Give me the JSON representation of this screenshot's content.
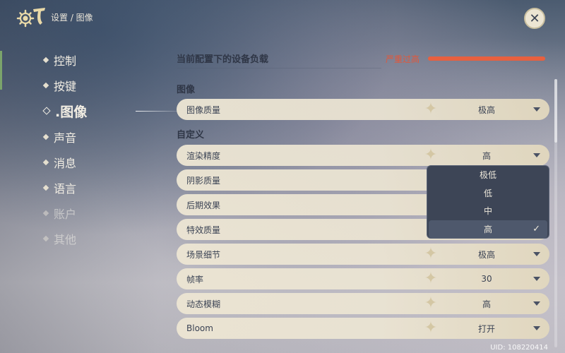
{
  "header": {
    "breadcrumb": "设置 / 图像",
    "close_label": "✕"
  },
  "sidebar": {
    "items": [
      {
        "label": "控制"
      },
      {
        "label": "按键"
      },
      {
        "label": ".图像"
      },
      {
        "label": "声音"
      },
      {
        "label": "消息"
      },
      {
        "label": "语言"
      },
      {
        "label": "账户"
      },
      {
        "label": "其他"
      }
    ]
  },
  "main": {
    "load_title": "当前配置下的设备负载",
    "load_status": "严重过高",
    "section_image": "图像",
    "section_custom": "自定义",
    "rows": [
      {
        "label": "图像质量",
        "value": "极高"
      },
      {
        "label": "渲染精度",
        "value": "高"
      },
      {
        "label": "阴影质量",
        "value": ""
      },
      {
        "label": "后期效果",
        "value": ""
      },
      {
        "label": "特效质量",
        "value": ""
      },
      {
        "label": "场景细节",
        "value": "极高"
      },
      {
        "label": "帧率",
        "value": "30"
      },
      {
        "label": "动态模糊",
        "value": "高"
      },
      {
        "label": "Bloom",
        "value": "打开"
      }
    ]
  },
  "dropdown": {
    "options": [
      "极低",
      "低",
      "中",
      "高"
    ],
    "selected_check": "✓"
  },
  "footer": {
    "uid": "UID: 108220414"
  },
  "colors": {
    "accent": "#e8603f",
    "row_bg": "#ece5d3",
    "dropdown_bg": "#3d4556"
  }
}
